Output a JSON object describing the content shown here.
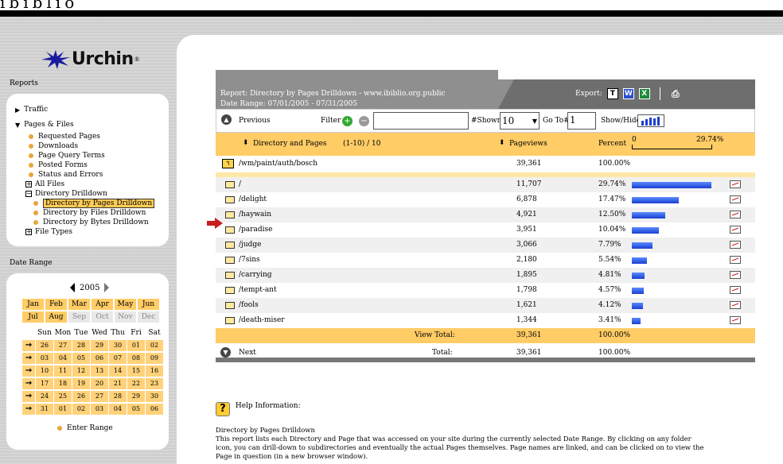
{
  "brand": "ibiblio",
  "sidebar": {
    "logo_text": "Urchin",
    "reports_label": "Reports",
    "items": [
      {
        "label": "Traffic",
        "type": "collapsed"
      },
      {
        "label": "Pages & Files",
        "type": "expanded"
      },
      {
        "label": "Requested Pages",
        "type": "leaf"
      },
      {
        "label": "Downloads",
        "type": "leaf"
      },
      {
        "label": "Page Query Terms",
        "type": "leaf"
      },
      {
        "label": "Posted Forms",
        "type": "leaf"
      },
      {
        "label": "Status and Errors",
        "type": "leaf"
      },
      {
        "label": "All Files",
        "type": "plus"
      },
      {
        "label": "Directory Drilldown",
        "type": "minus"
      },
      {
        "label": "Directory by Pages Drilldown",
        "type": "selected"
      },
      {
        "label": "Directory by Files Drilldown",
        "type": "subleaf"
      },
      {
        "label": "Directory by Bytes Drilldown",
        "type": "subleaf"
      },
      {
        "label": "File Types",
        "type": "plus"
      }
    ],
    "date_range_label": "Date Range"
  },
  "calendar": {
    "year": "2005",
    "months": [
      "Jan",
      "Feb",
      "Mar",
      "Apr",
      "May",
      "Jun",
      "Jul",
      "Aug",
      "Sep",
      "Oct",
      "Nov",
      "Dec"
    ],
    "weekdays": [
      "Sun",
      "Mon",
      "Tue",
      "Wed",
      "Thu",
      "Fri",
      "Sat"
    ],
    "weeks": [
      [
        "26",
        "27",
        "28",
        "29",
        "30",
        "01",
        "02"
      ],
      [
        "03",
        "04",
        "05",
        "06",
        "07",
        "08",
        "09"
      ],
      [
        "10",
        "11",
        "12",
        "13",
        "14",
        "15",
        "16"
      ],
      [
        "17",
        "18",
        "19",
        "20",
        "21",
        "22",
        "23"
      ],
      [
        "24",
        "25",
        "26",
        "27",
        "28",
        "29",
        "30"
      ],
      [
        "31",
        "01",
        "02",
        "03",
        "04",
        "05",
        "06"
      ]
    ],
    "enter_range": "Enter Range"
  },
  "report": {
    "title": "Report: Directory by Pages Drilldown - www.ibiblio.org.public",
    "date_range": "Date Range: 07/01/2005 - 07/31/2005",
    "export_label": "Export:",
    "previous": "Previous",
    "filter": "Filter",
    "filter_value": "",
    "shown_label": "#Shown",
    "shown_value": "10",
    "goto_label": "Go To#",
    "goto_value": "1",
    "showhide": "Show/Hide",
    "col_dir": "Directory and Pages",
    "col_range": "(1-10) / 10",
    "col_pageviews": "Pageviews",
    "col_percent": "Percent",
    "scale_min": "0",
    "scale_max": "29.74%",
    "parent": {
      "path": "/wm/paint/auth/bosch",
      "pageviews": "39,361",
      "percent": "100.00%"
    },
    "rows": [
      {
        "path": "/",
        "pageviews": "11,707",
        "percent": "29.74%",
        "pct": 29.74
      },
      {
        "path": "/delight",
        "pageviews": "6,878",
        "percent": "17.47%",
        "pct": 17.47
      },
      {
        "path": "/haywain",
        "pageviews": "4,921",
        "percent": "12.50%",
        "pct": 12.5
      },
      {
        "path": "/paradise",
        "pageviews": "3,951",
        "percent": "10.04%",
        "pct": 10.04
      },
      {
        "path": "/judge",
        "pageviews": "3,066",
        "percent": "7.79%",
        "pct": 7.79
      },
      {
        "path": "/7sins",
        "pageviews": "2,180",
        "percent": "5.54%",
        "pct": 5.54
      },
      {
        "path": "/carrying",
        "pageviews": "1,895",
        "percent": "4.81%",
        "pct": 4.81
      },
      {
        "path": "/tempt-ant",
        "pageviews": "1,798",
        "percent": "4.57%",
        "pct": 4.57
      },
      {
        "path": "/fools",
        "pageviews": "1,621",
        "percent": "4.12%",
        "pct": 4.12
      },
      {
        "path": "/death-miser",
        "pageviews": "1,344",
        "percent": "3.41%",
        "pct": 3.41
      }
    ],
    "view_total_label": "View Total:",
    "view_total": "39,361",
    "view_total_pct": "100.00%",
    "next": "Next",
    "total_label": "Total:",
    "total": "39,361",
    "total_pct": "100.00%"
  },
  "help": {
    "label": "Help Information:",
    "heading": "Directory by Pages Drilldown",
    "body": "This report lists each Directory and Page that was accessed on your site during the currently selected Date Range. By clicking on any folder icon, you can drill-down to subdirectories and eventually the actual Pages themselves. Page names are linked, and can be clicked on to view the Page in question (in a new browser window)."
  }
}
